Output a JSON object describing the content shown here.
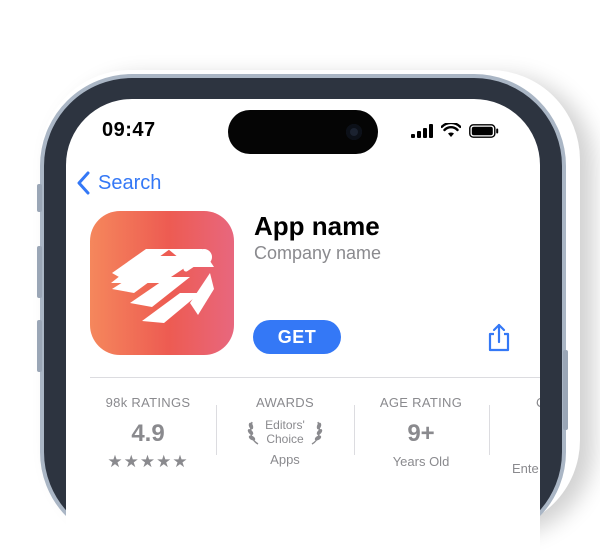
{
  "status_bar": {
    "time": "09:47"
  },
  "nav": {
    "back_label": "Search"
  },
  "app": {
    "name": "App name",
    "company": "Company name",
    "get_label": "GET"
  },
  "stats": {
    "ratings": {
      "label": "98k RATINGS",
      "value": "4.9",
      "stars": "★★★★★"
    },
    "awards": {
      "label": "AWARDS",
      "badge_line1": "Editors'",
      "badge_line2": "Choice",
      "sub": "Apps"
    },
    "age": {
      "label": "AGE RATING",
      "value": "9+",
      "sub": "Years Old"
    },
    "partial": {
      "label": "C",
      "sub": "Ente"
    }
  },
  "colors": {
    "accent": "#3478f6",
    "icon_gradient": [
      "#f5875c",
      "#ed5b52",
      "#e8677e"
    ]
  }
}
